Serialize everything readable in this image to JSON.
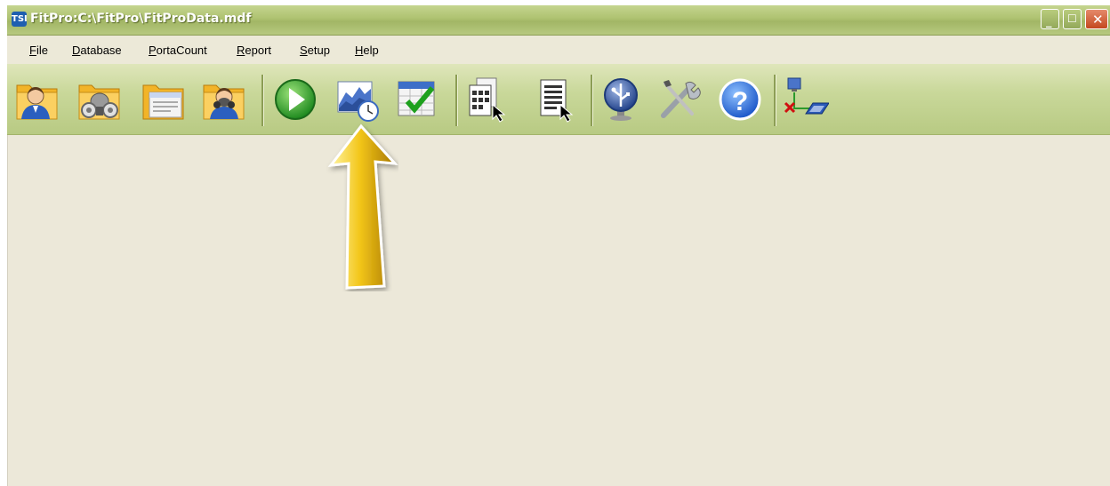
{
  "window": {
    "title": "FitPro:C:\\FitPro\\FitProData.mdf",
    "app_icon_text": "TSI"
  },
  "menu": [
    "File",
    "Database",
    "PortaCount",
    "Report",
    "Setup",
    "Help"
  ],
  "menu_mnemonic": [
    "F",
    "D",
    "P",
    "R",
    "S",
    "H"
  ],
  "toolbar": {
    "buttons": [
      {
        "name": "people-folder"
      },
      {
        "name": "respirator-folder"
      },
      {
        "name": "document-folder"
      },
      {
        "name": "person-respirator-folder"
      },
      {
        "name": "start-fit-test"
      },
      {
        "name": "real-time-chart"
      },
      {
        "name": "fit-test-schedule"
      },
      {
        "name": "report-select-1"
      },
      {
        "name": "report-select-2"
      },
      {
        "name": "usb-connect"
      },
      {
        "name": "setup-tools"
      },
      {
        "name": "help"
      },
      {
        "name": "portacount-disconnected"
      }
    ]
  },
  "colors": {
    "titlebar": "#aec270",
    "toolbar": "#c9d89a",
    "content": "#ece8d9",
    "arrow": "#f0c419"
  }
}
